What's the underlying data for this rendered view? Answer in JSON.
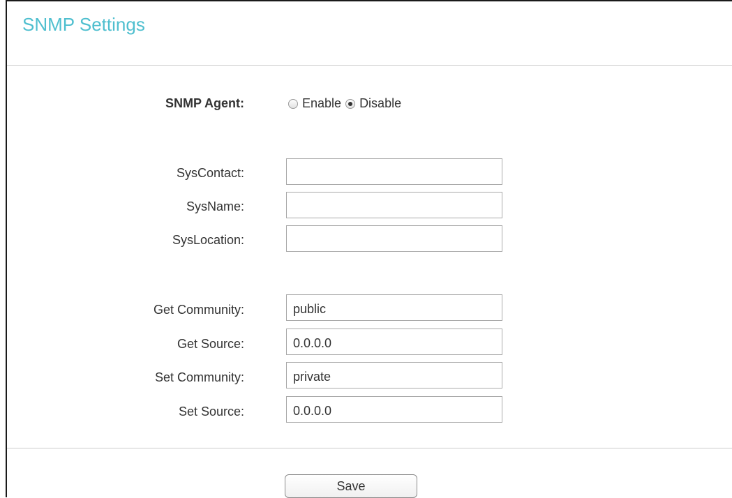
{
  "page": {
    "title": "SNMP Settings"
  },
  "agent": {
    "label": "SNMP Agent:",
    "options": [
      {
        "label": "Enable",
        "checked": false
      },
      {
        "label": "Disable",
        "checked": true
      }
    ]
  },
  "system": {
    "contact": {
      "label": "SysContact:",
      "value": ""
    },
    "name": {
      "label": "SysName:",
      "value": ""
    },
    "location": {
      "label": "SysLocation:",
      "value": ""
    }
  },
  "community": {
    "get_community": {
      "label": "Get Community:",
      "value": "public"
    },
    "get_source": {
      "label": "Get Source:",
      "value": "0.0.0.0"
    },
    "set_community": {
      "label": "Set Community:",
      "value": "private"
    },
    "set_source": {
      "label": "Set Source:",
      "value": "0.0.0.0"
    }
  },
  "actions": {
    "save_label": "Save"
  },
  "colors": {
    "title": "#4fbfcf",
    "border": "#1a1a1a",
    "divider": "#cccccc"
  }
}
